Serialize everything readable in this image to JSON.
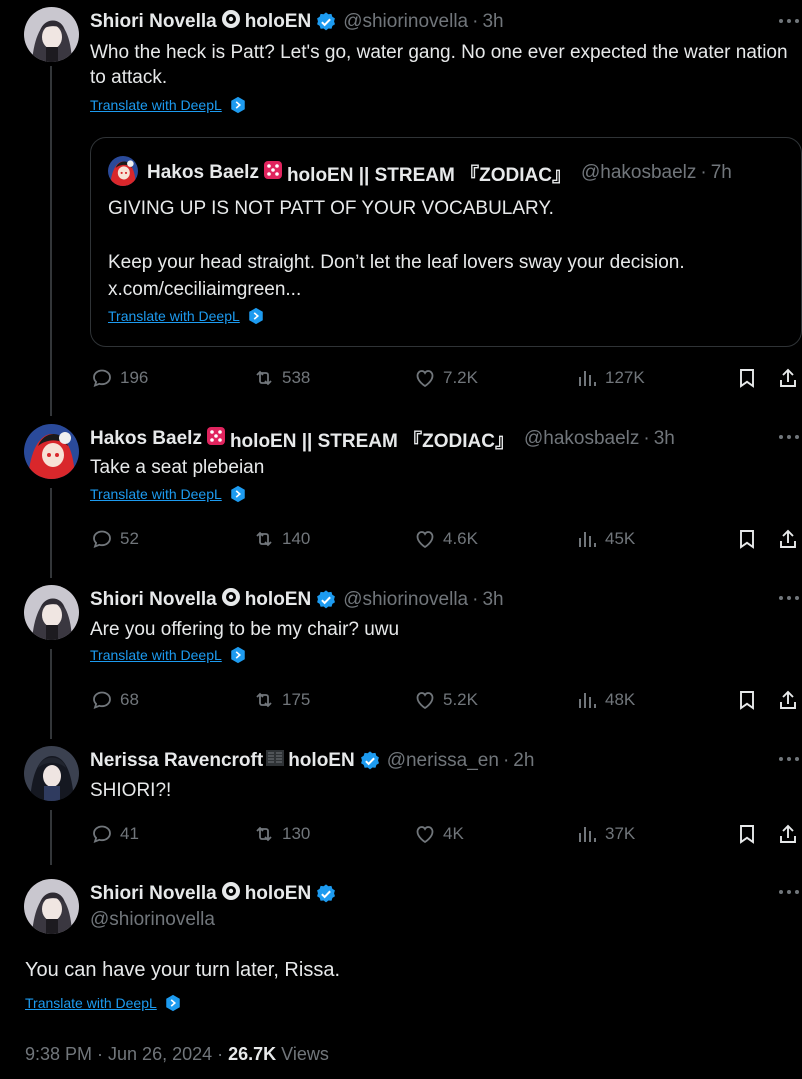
{
  "tweets": [
    {
      "name": "Shiori Novella",
      "emoji": "👁",
      "affiliation": "holoEN",
      "handle": "@shiorinovella",
      "time": "3h",
      "text": "Who the heck is Patt? Let's go, water gang. No one ever expected the water nation to attack.",
      "translate": "Translate with DeepL",
      "quote": {
        "name": "Hakos Baelz",
        "affiliation": "holoEN || STREAM 『ZODIAC』",
        "handle": "@hakosbaelz",
        "time": "7h",
        "line1": "GIVING UP IS NOT PATT OF YOUR VOCABULARY.",
        "line2": "Keep your head straight. Don’t let the leaf lovers sway your decision.",
        "link": "x.com/ceciliaimgreen...",
        "translate": "Translate with DeepL"
      },
      "stats": {
        "replies": "196",
        "reposts": "538",
        "likes": "7.2K",
        "views": "127K"
      }
    },
    {
      "name": "Hakos Baelz",
      "affiliation": "holoEN || STREAM 『ZODIAC』",
      "handle": "@hakosbaelz",
      "time": "3h",
      "text": "Take a seat plebeian",
      "translate": "Translate with DeepL",
      "stats": {
        "replies": "52",
        "reposts": "140",
        "likes": "4.6K",
        "views": "45K"
      }
    },
    {
      "name": "Shiori Novella",
      "emoji": "👁",
      "affiliation": "holoEN",
      "handle": "@shiorinovella",
      "time": "3h",
      "text": "Are you offering to be my chair? uwu",
      "translate": "Translate with DeepL",
      "stats": {
        "replies": "68",
        "reposts": "175",
        "likes": "5.2K",
        "views": "48K"
      }
    },
    {
      "name": "Nerissa Ravencroft",
      "affiliation": "holoEN",
      "handle": "@nerissa_en",
      "time": "2h",
      "text": "SHIORI?!",
      "stats": {
        "replies": "41",
        "reposts": "130",
        "likes": "4K",
        "views": "37K"
      }
    }
  ],
  "main": {
    "name": "Shiori Novella",
    "emoji": "👁",
    "affiliation": "holoEN",
    "handle": "@shiorinovella",
    "text": "You can have your turn later, Rissa.",
    "translate": "Translate with DeepL",
    "time": "9:38 PM · Jun 26, 2024 · ",
    "views_count": "26.7K",
    "views_label": " Views"
  },
  "colors": {
    "accent": "#1d9bf0",
    "muted": "#71767b",
    "text": "#e7e9ea",
    "border": "#2f3336"
  },
  "icons": [
    "reply-icon",
    "repost-icon",
    "like-icon",
    "views-icon",
    "bookmark-icon",
    "share-icon",
    "more-icon",
    "verified-icon",
    "deepl-icon",
    "dice-icon"
  ]
}
